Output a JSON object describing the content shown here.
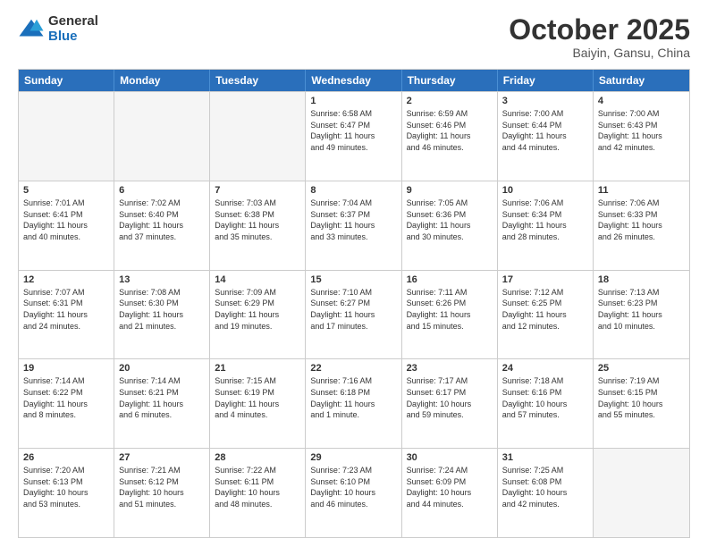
{
  "logo": {
    "general": "General",
    "blue": "Blue"
  },
  "title": "October 2025",
  "subtitle": "Baiyin, Gansu, China",
  "header": {
    "days": [
      "Sunday",
      "Monday",
      "Tuesday",
      "Wednesday",
      "Thursday",
      "Friday",
      "Saturday"
    ]
  },
  "weeks": [
    [
      {
        "day": "",
        "info": ""
      },
      {
        "day": "",
        "info": ""
      },
      {
        "day": "",
        "info": ""
      },
      {
        "day": "1",
        "info": "Sunrise: 6:58 AM\nSunset: 6:47 PM\nDaylight: 11 hours\nand 49 minutes."
      },
      {
        "day": "2",
        "info": "Sunrise: 6:59 AM\nSunset: 6:46 PM\nDaylight: 11 hours\nand 46 minutes."
      },
      {
        "day": "3",
        "info": "Sunrise: 7:00 AM\nSunset: 6:44 PM\nDaylight: 11 hours\nand 44 minutes."
      },
      {
        "day": "4",
        "info": "Sunrise: 7:00 AM\nSunset: 6:43 PM\nDaylight: 11 hours\nand 42 minutes."
      }
    ],
    [
      {
        "day": "5",
        "info": "Sunrise: 7:01 AM\nSunset: 6:41 PM\nDaylight: 11 hours\nand 40 minutes."
      },
      {
        "day": "6",
        "info": "Sunrise: 7:02 AM\nSunset: 6:40 PM\nDaylight: 11 hours\nand 37 minutes."
      },
      {
        "day": "7",
        "info": "Sunrise: 7:03 AM\nSunset: 6:38 PM\nDaylight: 11 hours\nand 35 minutes."
      },
      {
        "day": "8",
        "info": "Sunrise: 7:04 AM\nSunset: 6:37 PM\nDaylight: 11 hours\nand 33 minutes."
      },
      {
        "day": "9",
        "info": "Sunrise: 7:05 AM\nSunset: 6:36 PM\nDaylight: 11 hours\nand 30 minutes."
      },
      {
        "day": "10",
        "info": "Sunrise: 7:06 AM\nSunset: 6:34 PM\nDaylight: 11 hours\nand 28 minutes."
      },
      {
        "day": "11",
        "info": "Sunrise: 7:06 AM\nSunset: 6:33 PM\nDaylight: 11 hours\nand 26 minutes."
      }
    ],
    [
      {
        "day": "12",
        "info": "Sunrise: 7:07 AM\nSunset: 6:31 PM\nDaylight: 11 hours\nand 24 minutes."
      },
      {
        "day": "13",
        "info": "Sunrise: 7:08 AM\nSunset: 6:30 PM\nDaylight: 11 hours\nand 21 minutes."
      },
      {
        "day": "14",
        "info": "Sunrise: 7:09 AM\nSunset: 6:29 PM\nDaylight: 11 hours\nand 19 minutes."
      },
      {
        "day": "15",
        "info": "Sunrise: 7:10 AM\nSunset: 6:27 PM\nDaylight: 11 hours\nand 17 minutes."
      },
      {
        "day": "16",
        "info": "Sunrise: 7:11 AM\nSunset: 6:26 PM\nDaylight: 11 hours\nand 15 minutes."
      },
      {
        "day": "17",
        "info": "Sunrise: 7:12 AM\nSunset: 6:25 PM\nDaylight: 11 hours\nand 12 minutes."
      },
      {
        "day": "18",
        "info": "Sunrise: 7:13 AM\nSunset: 6:23 PM\nDaylight: 11 hours\nand 10 minutes."
      }
    ],
    [
      {
        "day": "19",
        "info": "Sunrise: 7:14 AM\nSunset: 6:22 PM\nDaylight: 11 hours\nand 8 minutes."
      },
      {
        "day": "20",
        "info": "Sunrise: 7:14 AM\nSunset: 6:21 PM\nDaylight: 11 hours\nand 6 minutes."
      },
      {
        "day": "21",
        "info": "Sunrise: 7:15 AM\nSunset: 6:19 PM\nDaylight: 11 hours\nand 4 minutes."
      },
      {
        "day": "22",
        "info": "Sunrise: 7:16 AM\nSunset: 6:18 PM\nDaylight: 11 hours\nand 1 minute."
      },
      {
        "day": "23",
        "info": "Sunrise: 7:17 AM\nSunset: 6:17 PM\nDaylight: 10 hours\nand 59 minutes."
      },
      {
        "day": "24",
        "info": "Sunrise: 7:18 AM\nSunset: 6:16 PM\nDaylight: 10 hours\nand 57 minutes."
      },
      {
        "day": "25",
        "info": "Sunrise: 7:19 AM\nSunset: 6:15 PM\nDaylight: 10 hours\nand 55 minutes."
      }
    ],
    [
      {
        "day": "26",
        "info": "Sunrise: 7:20 AM\nSunset: 6:13 PM\nDaylight: 10 hours\nand 53 minutes."
      },
      {
        "day": "27",
        "info": "Sunrise: 7:21 AM\nSunset: 6:12 PM\nDaylight: 10 hours\nand 51 minutes."
      },
      {
        "day": "28",
        "info": "Sunrise: 7:22 AM\nSunset: 6:11 PM\nDaylight: 10 hours\nand 48 minutes."
      },
      {
        "day": "29",
        "info": "Sunrise: 7:23 AM\nSunset: 6:10 PM\nDaylight: 10 hours\nand 46 minutes."
      },
      {
        "day": "30",
        "info": "Sunrise: 7:24 AM\nSunset: 6:09 PM\nDaylight: 10 hours\nand 44 minutes."
      },
      {
        "day": "31",
        "info": "Sunrise: 7:25 AM\nSunset: 6:08 PM\nDaylight: 10 hours\nand 42 minutes."
      },
      {
        "day": "",
        "info": ""
      }
    ]
  ]
}
